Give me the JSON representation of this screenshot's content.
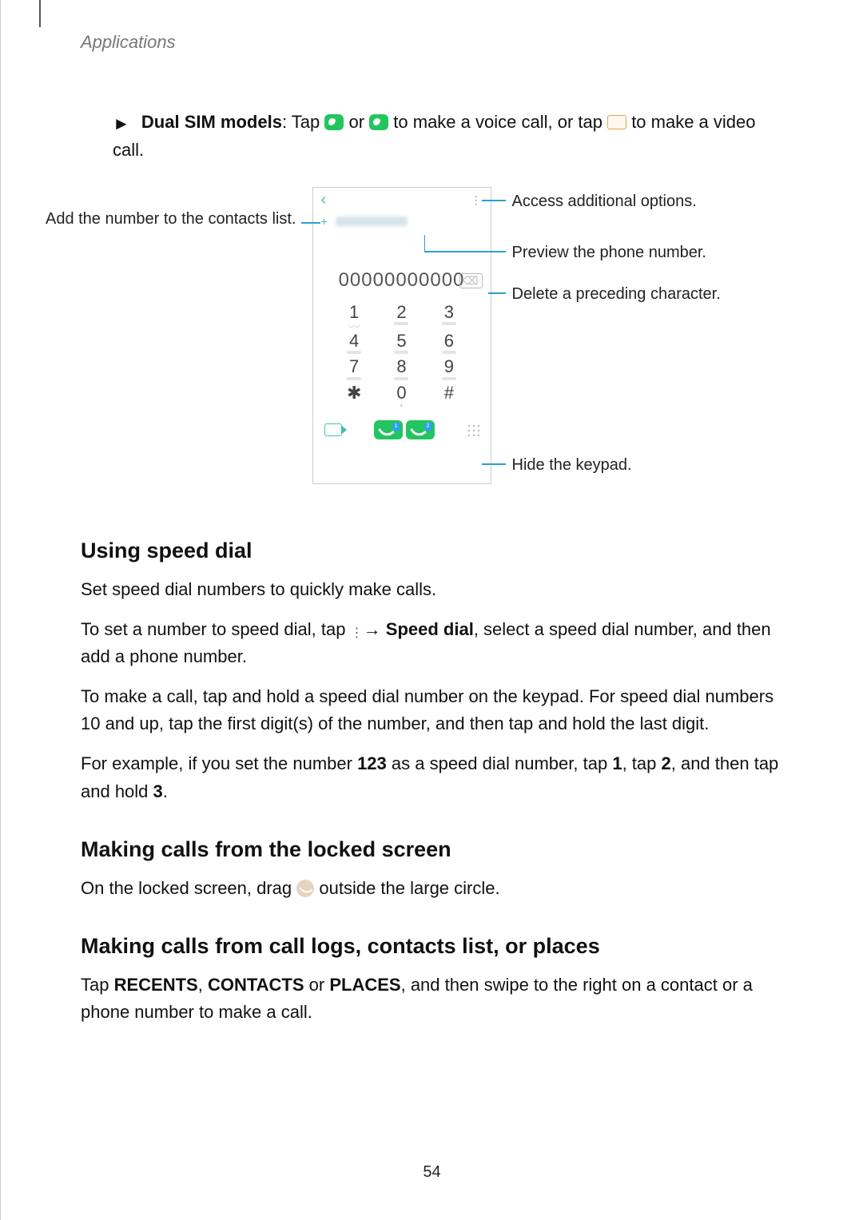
{
  "header": "Applications",
  "bullet_prefix": "Dual SIM models",
  "bullet_tap": ": Tap ",
  "bullet_or": " or ",
  "bullet_voice": " to make a voice call, or tap ",
  "bullet_video": " to make a video call.",
  "callouts": {
    "left_add": "Add the number to the contacts list.",
    "right_options": "Access additional options.",
    "right_preview": "Preview the phone number.",
    "right_delete": "Delete a preceding character.",
    "right_hide": "Hide the keypad."
  },
  "phone": {
    "number_display": "00000000000",
    "keys": [
      "1",
      "2",
      "3",
      "4",
      "5",
      "6",
      "7",
      "8",
      "9",
      "✱",
      "0",
      "#"
    ],
    "key0_sub": "+"
  },
  "h_speed": "Using speed dial",
  "p_speed1": "Set speed dial numbers to quickly make calls.",
  "p_speed2a": "To set a number to speed dial, tap ",
  "p_speed2b": " → ",
  "p_speed2_bold": "Speed dial",
  "p_speed2c": ", select a speed dial number, and then add a phone number.",
  "p_speed3": "To make a call, tap and hold a speed dial number on the keypad. For speed dial numbers 10 and up, tap the first digit(s) of the number, and then tap and hold the last digit.",
  "p_speed4a": "For example, if you set the number ",
  "p_speed4_123": "123",
  "p_speed4b": " as a speed dial number, tap ",
  "p_speed4_1": "1",
  "p_speed4c": ", tap ",
  "p_speed4_2": "2",
  "p_speed4d": ", and then tap and hold ",
  "p_speed4_3": "3",
  "p_speed4e": ".",
  "h_locked": "Making calls from the locked screen",
  "p_locked_a": "On the locked screen, drag ",
  "p_locked_b": " outside the large circle.",
  "h_logs": "Making calls from call logs, contacts list, or places",
  "p_logs_a": "Tap ",
  "p_logs_recents": "RECENTS",
  "p_logs_b": ", ",
  "p_logs_contacts": "CONTACTS",
  "p_logs_c": " or ",
  "p_logs_places": "PLACES",
  "p_logs_d": ", and then swipe to the right on a contact or a phone number to make a call.",
  "page_number": "54"
}
